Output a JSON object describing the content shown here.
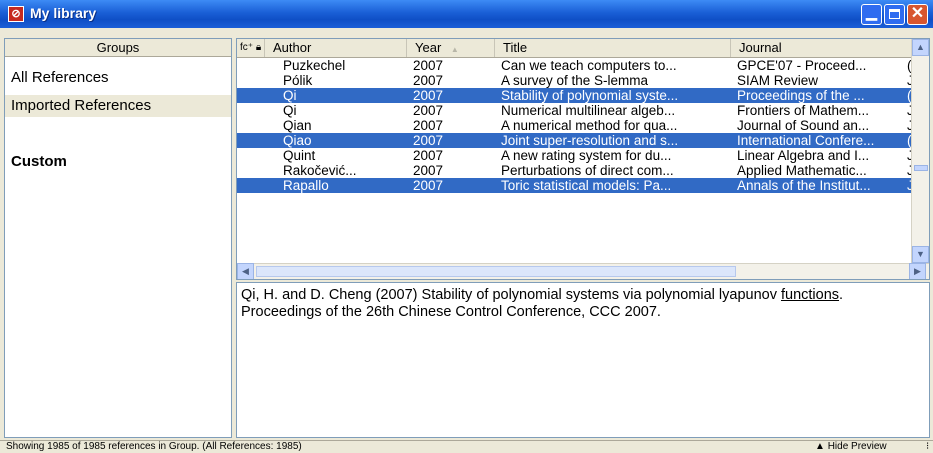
{
  "window": {
    "title": "My library",
    "app_icon": "reference-manager-icon"
  },
  "groups": {
    "header": "Groups",
    "items": [
      "All References",
      "Imported References"
    ],
    "selected_index": 1,
    "custom_label": "Custom"
  },
  "references": {
    "columns": [
      "",
      "Author",
      "Year",
      "Title",
      "Journal"
    ],
    "sort_arrow": "▲",
    "rows": [
      {
        "author": "Puzkechel",
        "year": "2007",
        "title": "Can we teach computers to...",
        "journal": "GPCE'07 - Proceed...",
        "extra": "(",
        "selected": false
      },
      {
        "author": "Pólik",
        "year": "2007",
        "title": "A survey of the S-lemma",
        "journal": "SIAM Review",
        "extra": "J",
        "selected": false
      },
      {
        "author": "Qi",
        "year": "2007",
        "title": "Stability of polynomial syste...",
        "journal": "Proceedings of the ...",
        "extra": "(",
        "selected": true
      },
      {
        "author": "Qi",
        "year": "2007",
        "title": "Numerical multilinear algeb...",
        "journal": "Frontiers of Mathem...",
        "extra": "J",
        "selected": false
      },
      {
        "author": "Qian",
        "year": "2007",
        "title": "A numerical method for qua...",
        "journal": "Journal of Sound an...",
        "extra": "J",
        "selected": false
      },
      {
        "author": "Qiao",
        "year": "2007",
        "title": "Joint super-resolution and s...",
        "journal": "International Confere...",
        "extra": "(",
        "selected": true
      },
      {
        "author": "Quint",
        "year": "2007",
        "title": "A new rating system for du...",
        "journal": "Linear Algebra and I...",
        "extra": "J",
        "selected": false
      },
      {
        "author": "Rakočević...",
        "year": "2007",
        "title": "Perturbations of direct com...",
        "journal": "Applied Mathematic...",
        "extra": "J",
        "selected": false
      },
      {
        "author": "Rapallo",
        "year": "2007",
        "title": "Toric statistical models: Pa...",
        "journal": "Annals of the Institut...",
        "extra": "J",
        "selected": true
      }
    ]
  },
  "preview": {
    "text_1": "Qi, H. and D. Cheng (2007) Stability of polynomial systems via polynomial lyapunov",
    "text_link": "functions",
    "text_2": ". Proceedings of the 26th Chinese Control Conference, CCC 2007."
  },
  "status": {
    "text": "Showing 1985 of 1985 references in Group. (All References: 1985)",
    "hide_preview": "Hide Preview",
    "grip": "⁝"
  },
  "colors": {
    "selection": "#316ac5",
    "titlebar": "#0f4fc6",
    "chrome": "#ece9d8"
  }
}
